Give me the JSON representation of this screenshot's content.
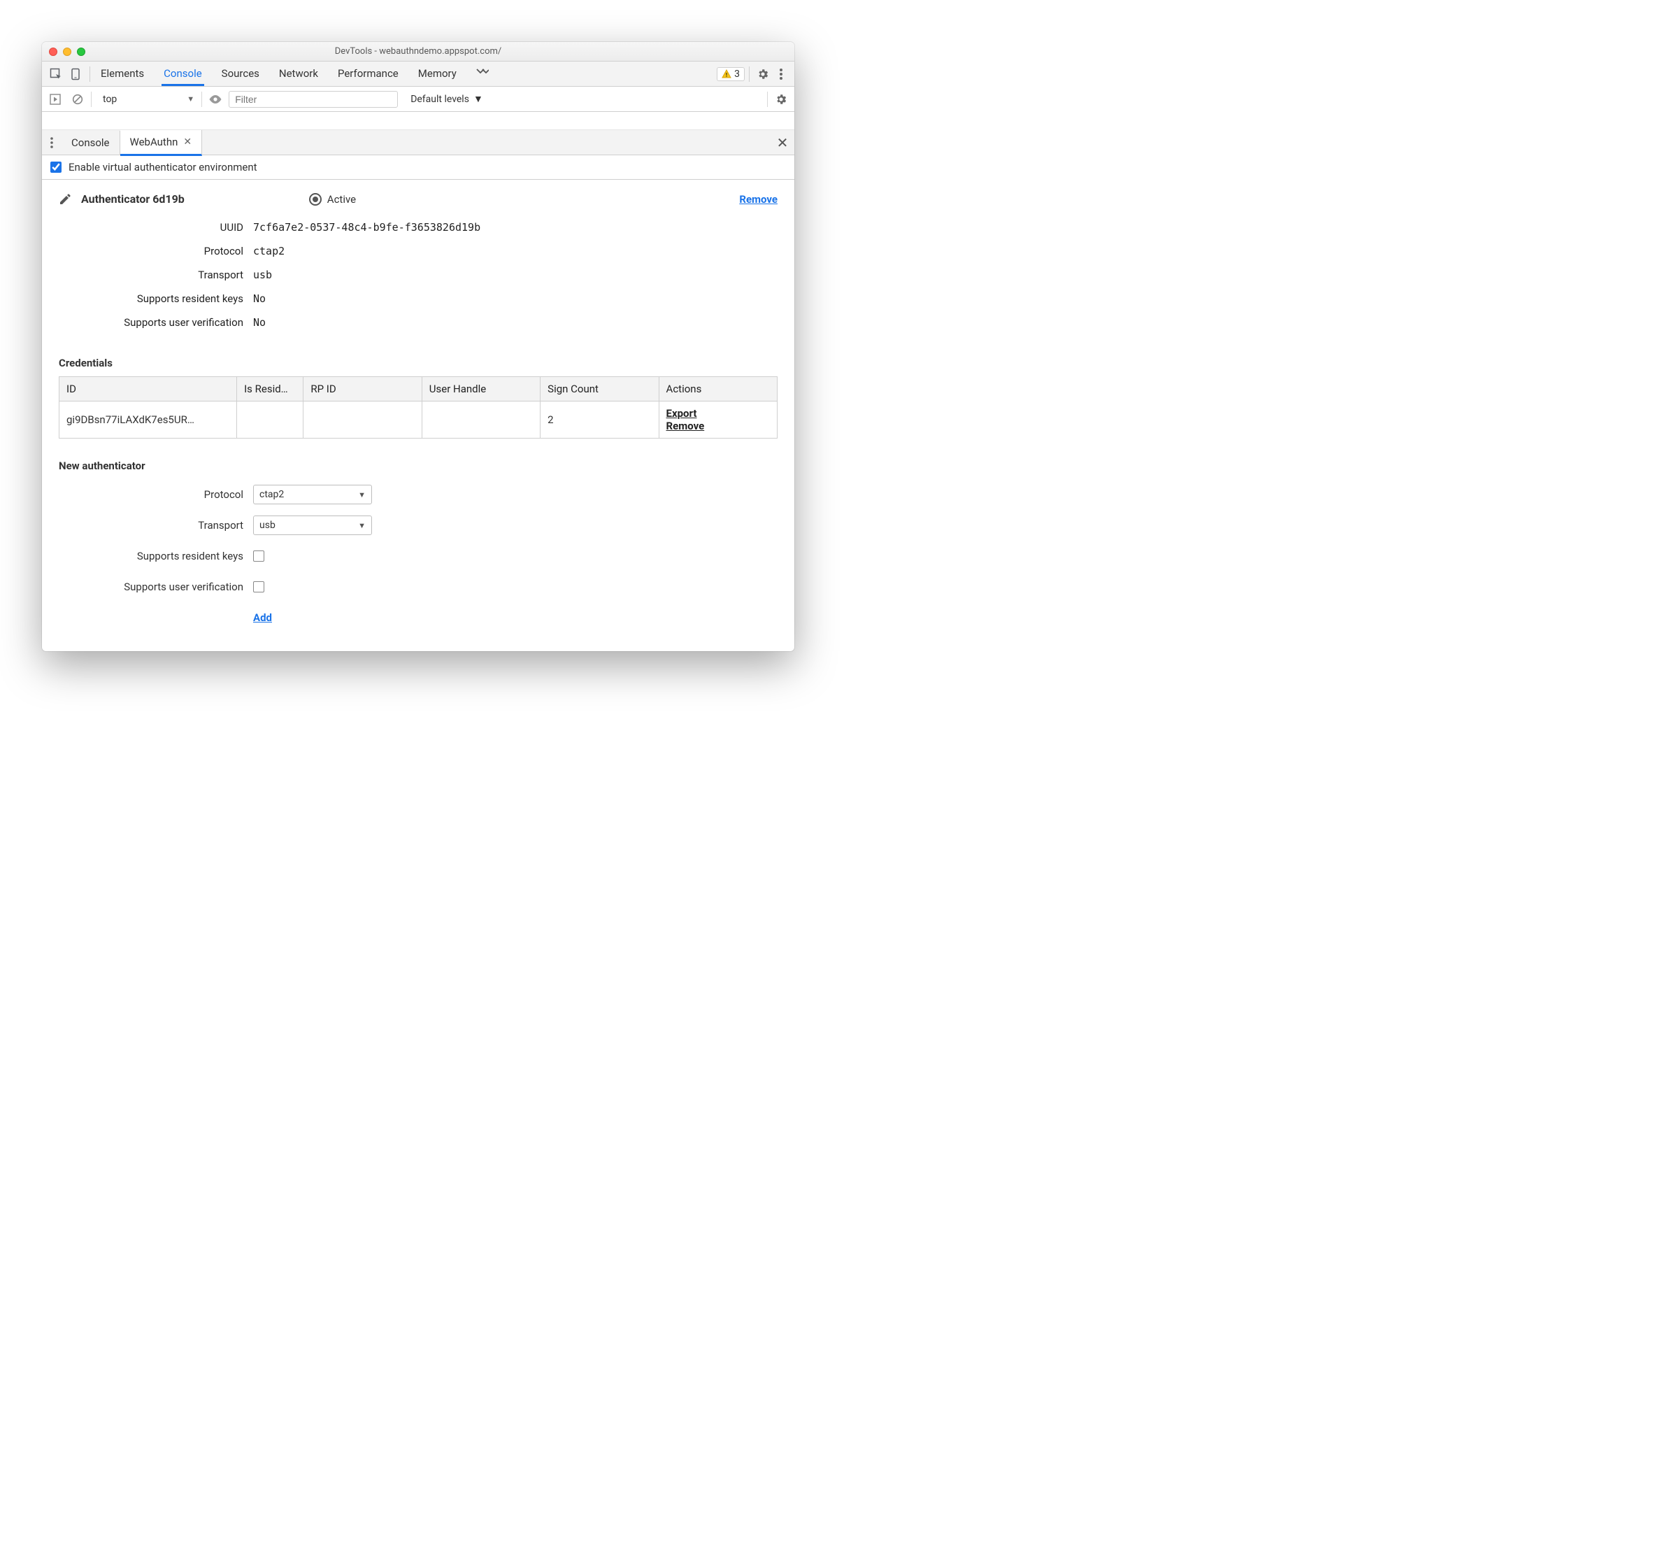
{
  "window": {
    "title": "DevTools - webauthndemo.appspot.com/"
  },
  "tabs": {
    "items": [
      "Elements",
      "Console",
      "Sources",
      "Network",
      "Performance",
      "Memory"
    ],
    "active": "Console",
    "badge_count": "3"
  },
  "consolebar": {
    "context": "top",
    "filter_placeholder": "Filter",
    "levels": "Default levels"
  },
  "drawer": {
    "tabs": [
      "Console",
      "WebAuthn"
    ],
    "active": "WebAuthn"
  },
  "enable": {
    "label": "Enable virtual authenticator environment",
    "checked": true
  },
  "authenticator": {
    "title": "Authenticator 6d19b",
    "active_label": "Active",
    "remove_label": "Remove",
    "fields": {
      "uuid_label": "UUID",
      "uuid": "7cf6a7e2-0537-48c4-b9fe-f3653826d19b",
      "protocol_label": "Protocol",
      "protocol": "ctap2",
      "transport_label": "Transport",
      "transport": "usb",
      "resident_label": "Supports resident keys",
      "resident": "No",
      "userverif_label": "Supports user verification",
      "userverif": "No"
    }
  },
  "credentials": {
    "title": "Credentials",
    "headers": {
      "id": "ID",
      "is_resident": "Is Resid…",
      "rp_id": "RP ID",
      "user_handle": "User Handle",
      "sign_count": "Sign Count",
      "actions": "Actions"
    },
    "rows": [
      {
        "id": "gi9DBsn77iLAXdK7es5UR…",
        "is_resident": "",
        "rp_id": "",
        "user_handle": "",
        "sign_count": "2",
        "export": "Export",
        "remove": "Remove"
      }
    ]
  },
  "new_auth": {
    "title": "New authenticator",
    "protocol_label": "Protocol",
    "protocol": "ctap2",
    "transport_label": "Transport",
    "transport": "usb",
    "resident_label": "Supports resident keys",
    "userverif_label": "Supports user verification",
    "add_label": "Add"
  }
}
